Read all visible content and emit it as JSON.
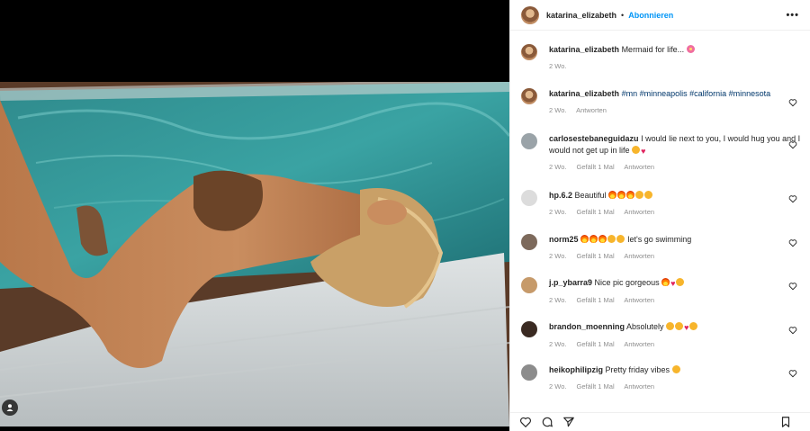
{
  "header": {
    "username": "katarina_elizabeth",
    "dot": "•",
    "follow_label": "Abonnieren",
    "more_label": "•••"
  },
  "comments": [
    {
      "user": "katarina_elizabeth",
      "text": "Mermaid for life...",
      "emoji": [
        "flower"
      ],
      "time": "2 Wo.",
      "likes": "",
      "reply": ""
    },
    {
      "user": "katarina_elizabeth",
      "text": "#mn #minneapolis #california #minnesota",
      "emoji": [],
      "time": "2 Wo.",
      "likes": "",
      "reply": "Antworten"
    },
    {
      "user": "carlosestebaneguidazu",
      "text": "I would lie next to you, I would hug you and I would not get up in life",
      "emoji": [
        "face",
        "heart"
      ],
      "time": "2 Wo.",
      "likes": "Gefällt 1 Mal",
      "reply": "Antworten"
    },
    {
      "user": "hp.6.2",
      "text": "Beautiful",
      "emoji": [
        "fire",
        "fire",
        "fire",
        "face",
        "face"
      ],
      "time": "2 Wo.",
      "likes": "Gefällt 1 Mal",
      "reply": "Antworten"
    },
    {
      "user": "norm25",
      "text": "let's go swimming",
      "emoji": [
        "fire",
        "fire",
        "fire",
        "face",
        "face"
      ],
      "time": "2 Wo.",
      "likes": "Gefällt 1 Mal",
      "reply": "Antworten"
    },
    {
      "user": "j.p_ybarra9",
      "text": "Nice pic gorgeous",
      "emoji": [
        "fire",
        "heart",
        "face"
      ],
      "time": "2 Wo.",
      "likes": "Gefällt 1 Mal",
      "reply": "Antworten"
    },
    {
      "user": "brandon_moenning",
      "text": "Absolutely",
      "emoji": [
        "face",
        "face",
        "heart",
        "face"
      ],
      "time": "2 Wo.",
      "likes": "Gefällt 1 Mal",
      "reply": "Antworten"
    },
    {
      "user": "heikophilipzig",
      "text": "Pretty friday vibes",
      "emoji": [
        "face"
      ],
      "time": "2 Wo.",
      "likes": "Gefällt 1 Mal",
      "reply": "Antworten"
    }
  ],
  "icons": {
    "like": "heart-icon",
    "comment": "comment-icon",
    "share": "share-icon",
    "save": "bookmark-icon",
    "user_tag": "user-tag-icon"
  },
  "colors": {
    "link": "#0095f6",
    "muted": "#8e8e8e",
    "text": "#262626"
  }
}
